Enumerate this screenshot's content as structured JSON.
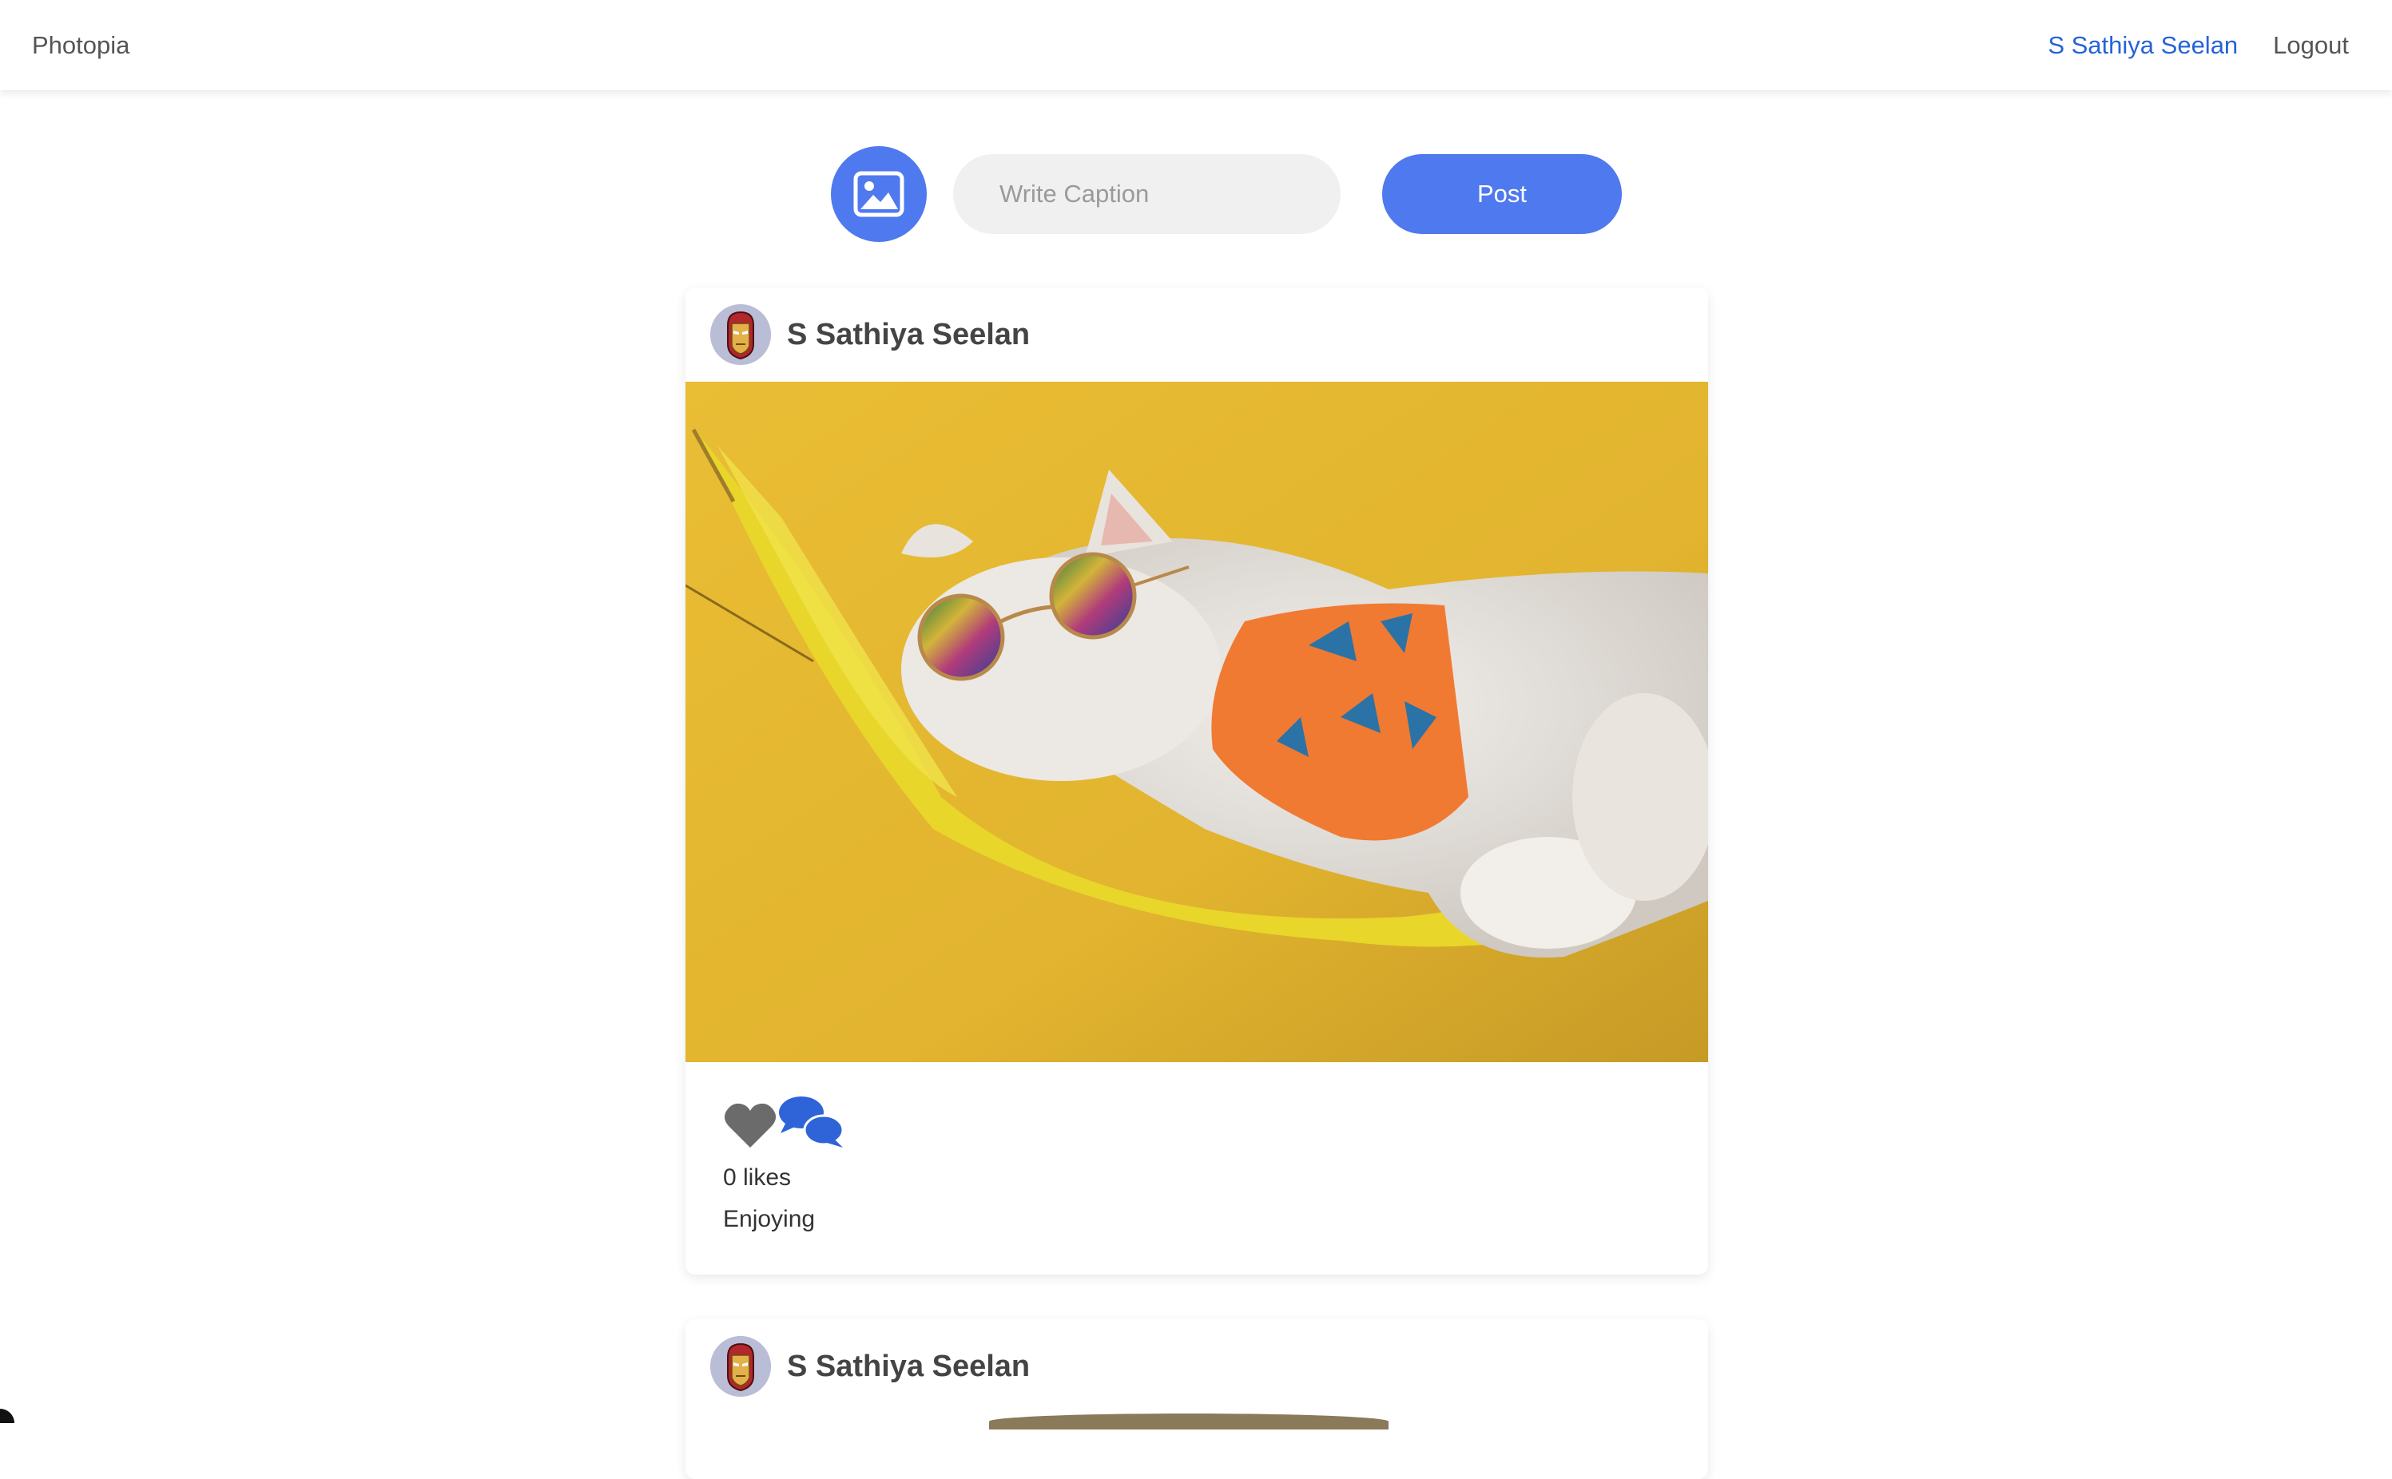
{
  "nav": {
    "brand": "Photopia",
    "user": "S Sathiya Seelan",
    "logout": "Logout"
  },
  "composer": {
    "upload_icon": "image-icon",
    "caption_placeholder": "Write Caption",
    "caption_value": "",
    "post_label": "Post"
  },
  "posts": [
    {
      "author": "S Sathiya Seelan",
      "avatar_icon": "iron-man-avatar",
      "image_subject": "cat-in-hammock",
      "likes": "0 likes",
      "caption": "Enjoying"
    },
    {
      "author": "S Sathiya Seelan",
      "avatar_icon": "iron-man-avatar"
    }
  ],
  "colors": {
    "accent": "#4f79ee",
    "link": "#2563d9",
    "like_icon": "#6b6b6b",
    "comment_icon": "#2f63d8"
  }
}
